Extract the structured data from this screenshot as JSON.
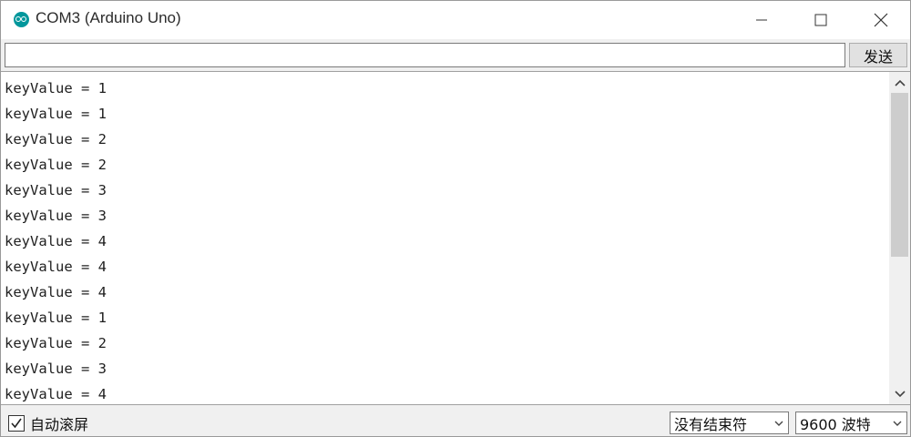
{
  "window": {
    "title": "COM3 (Arduino Uno)"
  },
  "send_bar": {
    "input_value": "",
    "send_label": "发送"
  },
  "output": {
    "lines": [
      "keyValue = 1",
      "keyValue = 1",
      "keyValue = 2",
      "keyValue = 2",
      "keyValue = 3",
      "keyValue = 3",
      "keyValue = 4",
      "keyValue = 4",
      "keyValue = 4",
      "keyValue = 1",
      "keyValue = 2",
      "keyValue = 3",
      "keyValue = 4"
    ]
  },
  "status": {
    "autoscroll_label": "自动滚屏",
    "autoscroll_checked": true,
    "line_ending": "没有结束符",
    "baud_rate": "9600 波特"
  },
  "icons": {
    "app": "arduino-logo-icon",
    "minimize": "minimize-icon",
    "maximize": "maximize-icon",
    "close": "close-icon"
  },
  "colors": {
    "brand": "#00979c",
    "window_bg": "#f0f0f0",
    "scroll_thumb": "#cdcdcd"
  }
}
